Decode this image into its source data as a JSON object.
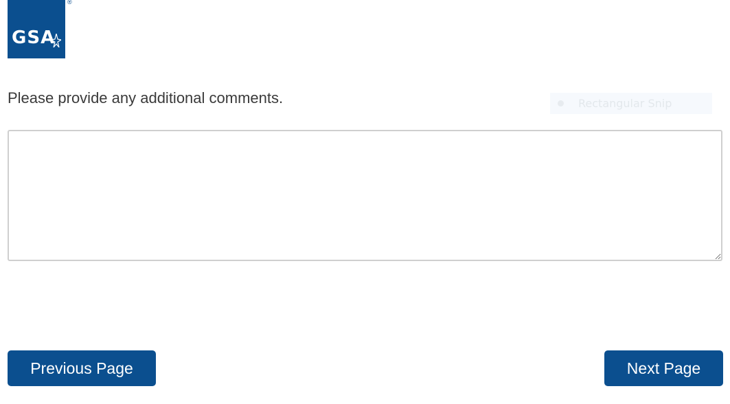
{
  "logo": {
    "text": "GSA",
    "registered_mark": "®",
    "brand_color": "#0b4f8f"
  },
  "question": {
    "text": "Please provide any additional comments."
  },
  "snip_overlay": {
    "label": "Rectangular Snip"
  },
  "comment_field": {
    "value": "",
    "placeholder": ""
  },
  "navigation": {
    "previous_label": "Previous Page",
    "next_label": "Next Page",
    "button_color": "#0b4f8f"
  }
}
